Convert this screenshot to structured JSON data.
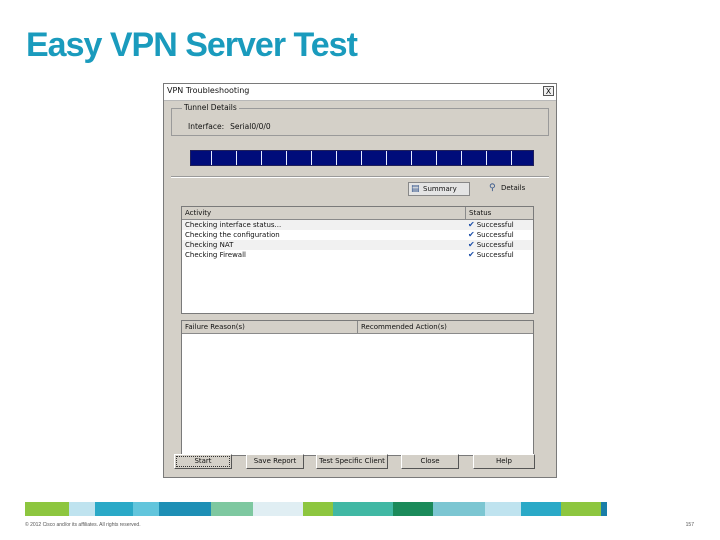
{
  "slide": {
    "title": "Easy VPN Server Test",
    "footer": "© 2012 Cisco and/or its affiliates. All rights reserved.",
    "page_number": "157"
  },
  "window": {
    "title": "VPN Troubleshooting",
    "close_glyph": "X",
    "tunnel_group": {
      "legend": "Tunnel Details",
      "interface_label": "Interface:",
      "interface_value": "Serial0/0/0"
    },
    "progress": 1.0,
    "tabs": {
      "summary": "Summary",
      "details": "Details"
    },
    "activity_table": {
      "columns": [
        "Activity",
        "Status"
      ],
      "rows": [
        {
          "activity": "Checking interface status...",
          "status": "Successful"
        },
        {
          "activity": "Checking the configuration",
          "status": "Successful"
        },
        {
          "activity": "Checking NAT",
          "status": "Successful"
        },
        {
          "activity": "Checking Firewall",
          "status": "Successful"
        }
      ]
    },
    "results_table": {
      "columns": [
        "Failure Reason(s)",
        "Recommended Action(s)"
      ]
    },
    "buttons": {
      "start": "Start",
      "save_report": "Save Report",
      "test_specific_client": "Test Specific Client",
      "close": "Close",
      "help": "Help"
    }
  },
  "colors": {
    "title": "#1a9bbd",
    "progress_bar": "#000c7a",
    "window_face": "#d4d0c8",
    "footer_band": [
      "#8dc63f",
      "#bfe3ef",
      "#2aa9c7",
      "#62c5dc",
      "#1e8fb5",
      "#7ec8a0",
      "#e0eef3",
      "#8dc63f",
      "#41b8a4",
      "#1b8a5a",
      "#7cc6d2",
      "#bfe3ef",
      "#2aa9c7",
      "#8dc63f",
      "#1a7ea8"
    ]
  },
  "icons": {
    "summary": "summary-icon",
    "details": "details-icon",
    "status": "check-icon"
  }
}
